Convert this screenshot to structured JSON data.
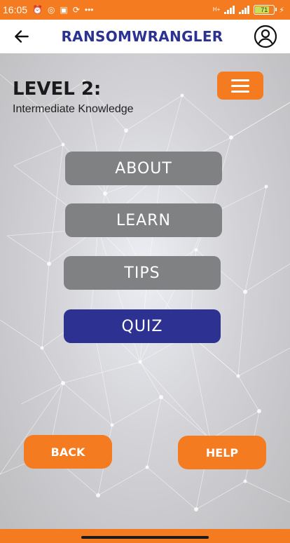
{
  "status_bar": {
    "time": "16:05",
    "battery_level": "71",
    "network_label": "H+"
  },
  "app_bar": {
    "title": "RANSOMWRANGLER"
  },
  "level": {
    "title": "LEVEL 2:",
    "subtitle": "Intermediate Knowledge"
  },
  "menu": [
    {
      "label": "ABOUT",
      "style": "grey"
    },
    {
      "label": "LEARN",
      "style": "grey"
    },
    {
      "label": "TIPS",
      "style": "grey"
    },
    {
      "label": "QUIZ",
      "style": "blue"
    }
  ],
  "footer": {
    "back_label": "BACK",
    "help_label": "HELP"
  },
  "colors": {
    "accent_orange": "#f47b20",
    "brand_blue": "#2b3290",
    "button_grey": "#808183"
  }
}
